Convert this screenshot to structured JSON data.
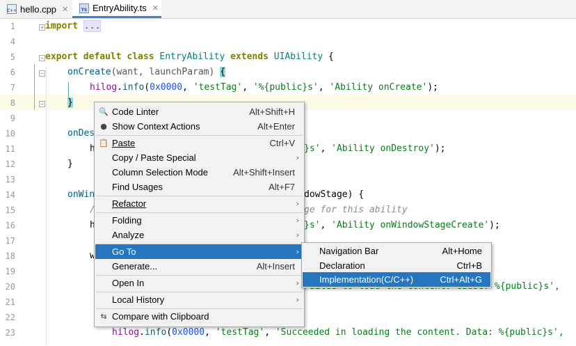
{
  "tabs": [
    {
      "label": "hello.cpp",
      "icon": "cpp-file-icon",
      "badge": "C++"
    },
    {
      "label": "EntryAbility.ts",
      "icon": "ts-file-icon",
      "badge": "TS"
    }
  ],
  "line_numbers": [
    "1",
    "4",
    "5",
    "6",
    "7",
    "8",
    "9",
    "10",
    "11",
    "12",
    "13",
    "14",
    "15",
    "16",
    "17",
    "18",
    "19",
    "20",
    "21",
    "22",
    "23"
  ],
  "code": {
    "l1_kw": "import",
    "l1_dots": "...",
    "l5_a": "export default class",
    "l5_b": "EntryAbility",
    "l5_c": "extends",
    "l5_d": "UIAbility",
    "l5_e": "{",
    "l6_fn": "onCreate",
    "l6_rest": "(want, launchParam)",
    "l6_brace": "{",
    "l7_obj": "hilog",
    "l7_dot": ".",
    "l7_fn": "info",
    "l7_p1": "(",
    "l7_num": "0x0000",
    "l7_p2": ", ",
    "l7_s1": "'testTag'",
    "l7_p3": ", ",
    "l7_s2": "'%{public}s'",
    "l7_p4": ", ",
    "l7_s3": "'Ability onCreate'",
    "l7_p5": ");",
    "l8": "}",
    "l10_fn": "onDes",
    "l11_pre": "hi",
    "l11_s": "}s'",
    "l11_rest": ", ",
    "l11_s2": "'Ability onDestroy'",
    "l11_end": ");",
    "l12": "}",
    "l14_fn": "onWin",
    "l14_rest": "dowStage) {",
    "l15_pre": "/",
    "l15_cmt": "ge for this ability",
    "l16_pre": "h",
    "l16_s": "}s'",
    "l16_rest": ", ",
    "l16_s2": "'Ability onWindowStageCreate'",
    "l16_end": ");",
    "l18_pre": "w",
    "l20_rest": "Failed to load the content. Cause: %{public}s',",
    "l23_obj": "hilog",
    "l23_dot": ".",
    "l23_fn": "info",
    "l23_p1": "(",
    "l23_num": "0x0000",
    "l23_p2": ", ",
    "l23_s1": "'testTag'",
    "l23_p3": ", ",
    "l23_s2": "'Succeeded in loading the content. Data: %{public}s',"
  },
  "context_menu": {
    "items": [
      {
        "label": "Code Linter",
        "shortcut": "Alt+Shift+H",
        "icon": "linter-icon"
      },
      {
        "label": "Show Context Actions",
        "shortcut": "Alt+Enter",
        "icon": "lightbulb-icon"
      },
      {
        "label": "Paste",
        "shortcut": "Ctrl+V",
        "icon": "paste-icon"
      },
      {
        "label": "Copy / Paste Special",
        "shortcut": "",
        "submenu": true
      },
      {
        "label": "Column Selection Mode",
        "shortcut": "Alt+Shift+Insert"
      },
      {
        "label": "Find Usages",
        "shortcut": "Alt+F7"
      },
      {
        "label": "Refactor",
        "shortcut": "",
        "submenu": true
      },
      {
        "label": "Folding",
        "shortcut": "",
        "submenu": true
      },
      {
        "label": "Analyze",
        "shortcut": "",
        "submenu": true
      },
      {
        "label": "Go To",
        "shortcut": "",
        "submenu": true,
        "selected": true
      },
      {
        "label": "Generate...",
        "shortcut": "Alt+Insert"
      },
      {
        "label": "Open In",
        "shortcut": "",
        "submenu": true
      },
      {
        "label": "Local History",
        "shortcut": "",
        "submenu": true
      },
      {
        "label": "Compare with Clipboard",
        "shortcut": "",
        "icon": "compare-icon"
      }
    ]
  },
  "goto_submenu": {
    "items": [
      {
        "label": "Navigation Bar",
        "shortcut": "Alt+Home"
      },
      {
        "label": "Declaration",
        "shortcut": "Ctrl+B"
      },
      {
        "label": "Implementation(C/C++)",
        "shortcut": "Ctrl+Alt+G",
        "selected": true
      }
    ]
  },
  "colors": {
    "selection": "#2675bf",
    "menu_bg": "#f2f2f2",
    "current_line": "#fdfae8"
  }
}
